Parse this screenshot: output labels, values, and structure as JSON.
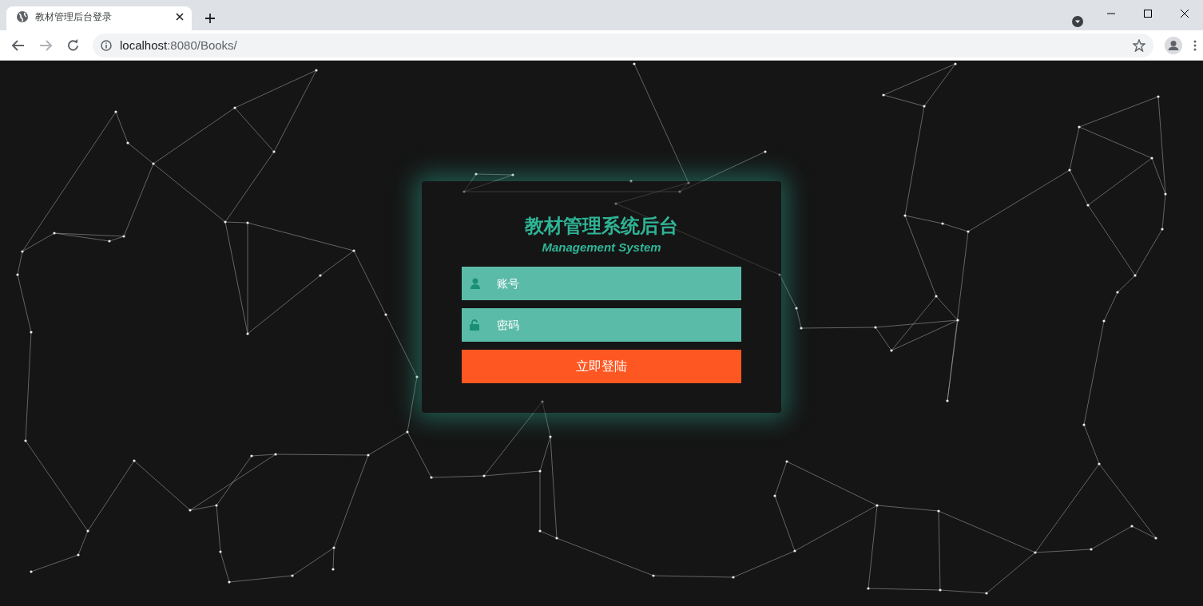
{
  "browser": {
    "tab": {
      "title": "教材管理后台登录"
    },
    "address": {
      "host": "localhost",
      "rest": ":8080/Books/"
    }
  },
  "login": {
    "title": "教材管理系统后台",
    "subtitle": "Management System",
    "fields": [
      {
        "kind": "user",
        "placeholder": "账号"
      },
      {
        "kind": "password",
        "placeholder": "密码"
      }
    ],
    "button": "立即登陆"
  }
}
